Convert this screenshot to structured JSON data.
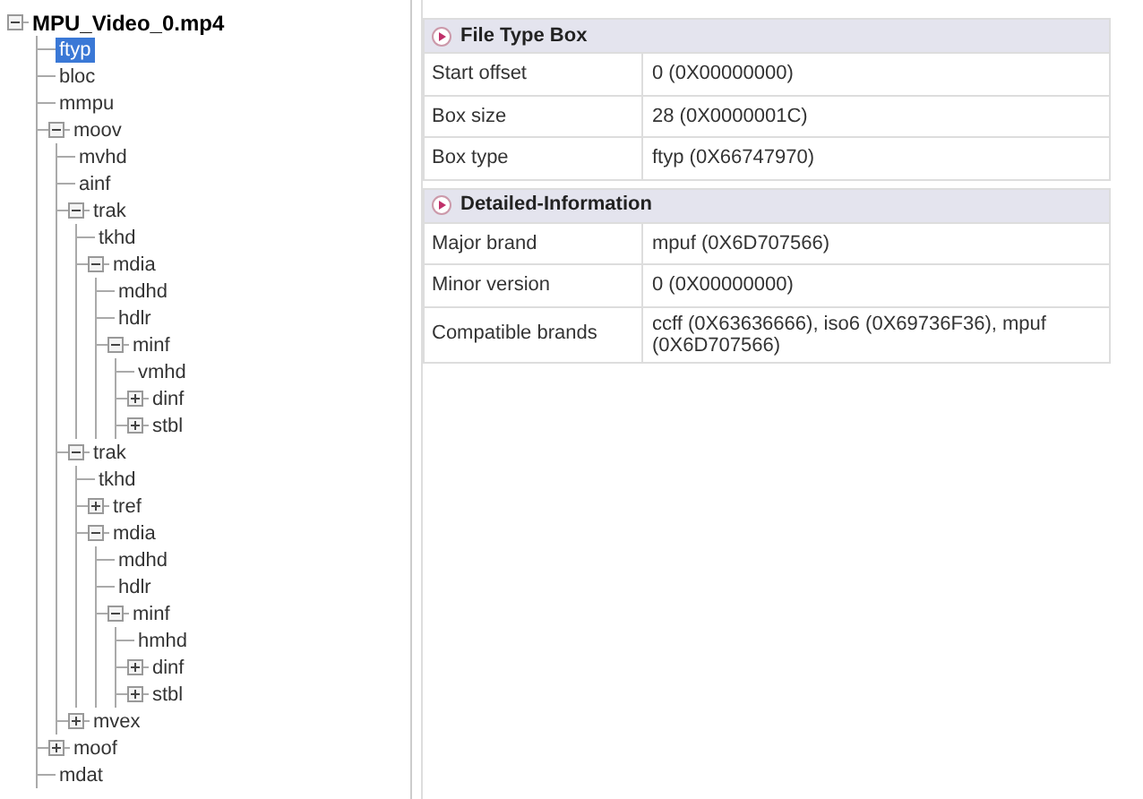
{
  "tree": {
    "label": "MPU_Video_0.mp4",
    "kind": "branch",
    "expanded": true,
    "selected": false,
    "children": [
      {
        "label": "ftyp",
        "kind": "leaf",
        "selected": true
      },
      {
        "label": "bloc",
        "kind": "leaf",
        "selected": false
      },
      {
        "label": "mmpu",
        "kind": "leaf",
        "selected": false
      },
      {
        "label": "moov",
        "kind": "branch",
        "expanded": true,
        "selected": false,
        "children": [
          {
            "label": "mvhd",
            "kind": "leaf",
            "selected": false
          },
          {
            "label": "ainf",
            "kind": "leaf",
            "selected": false
          },
          {
            "label": "trak",
            "kind": "branch",
            "expanded": true,
            "selected": false,
            "children": [
              {
                "label": "tkhd",
                "kind": "leaf",
                "selected": false
              },
              {
                "label": "mdia",
                "kind": "branch",
                "expanded": true,
                "selected": false,
                "children": [
                  {
                    "label": "mdhd",
                    "kind": "leaf",
                    "selected": false
                  },
                  {
                    "label": "hdlr",
                    "kind": "leaf",
                    "selected": false
                  },
                  {
                    "label": "minf",
                    "kind": "branch",
                    "expanded": true,
                    "selected": false,
                    "children": [
                      {
                        "label": "vmhd",
                        "kind": "leaf",
                        "selected": false
                      },
                      {
                        "label": "dinf",
                        "kind": "branch",
                        "expanded": false,
                        "selected": false
                      },
                      {
                        "label": "stbl",
                        "kind": "branch",
                        "expanded": false,
                        "selected": false
                      }
                    ]
                  }
                ]
              }
            ]
          },
          {
            "label": "trak",
            "kind": "branch",
            "expanded": true,
            "selected": false,
            "children": [
              {
                "label": "tkhd",
                "kind": "leaf",
                "selected": false
              },
              {
                "label": "tref",
                "kind": "branch",
                "expanded": false,
                "selected": false
              },
              {
                "label": "mdia",
                "kind": "branch",
                "expanded": true,
                "selected": false,
                "children": [
                  {
                    "label": "mdhd",
                    "kind": "leaf",
                    "selected": false
                  },
                  {
                    "label": "hdlr",
                    "kind": "leaf",
                    "selected": false
                  },
                  {
                    "label": "minf",
                    "kind": "branch",
                    "expanded": true,
                    "selected": false,
                    "children": [
                      {
                        "label": "hmhd",
                        "kind": "leaf",
                        "selected": false
                      },
                      {
                        "label": "dinf",
                        "kind": "branch",
                        "expanded": false,
                        "selected": false
                      },
                      {
                        "label": "stbl",
                        "kind": "branch",
                        "expanded": false,
                        "selected": false
                      }
                    ]
                  }
                ]
              }
            ]
          },
          {
            "label": "mvex",
            "kind": "branch",
            "expanded": false,
            "selected": false
          }
        ]
      },
      {
        "label": "moof",
        "kind": "branch",
        "expanded": false,
        "selected": false
      },
      {
        "label": "mdat",
        "kind": "leaf",
        "selected": false
      }
    ]
  },
  "sections": [
    {
      "title": "File Type Box",
      "rows": [
        {
          "label": "Start offset",
          "value": "0 (0X00000000)"
        },
        {
          "label": "Box size",
          "value": "28 (0X0000001C)"
        },
        {
          "label": "Box type",
          "value": "ftyp (0X66747970)"
        }
      ]
    },
    {
      "title": "Detailed-Information",
      "rows": [
        {
          "label": "Major brand",
          "value": "mpuf (0X6D707566)"
        },
        {
          "label": "Minor version",
          "value": "0 (0X00000000)"
        },
        {
          "label": "Compatible brands",
          "value": "ccff (0X63636666), iso6 (0X69736F36), mpuf (0X6D707566)"
        }
      ]
    }
  ]
}
